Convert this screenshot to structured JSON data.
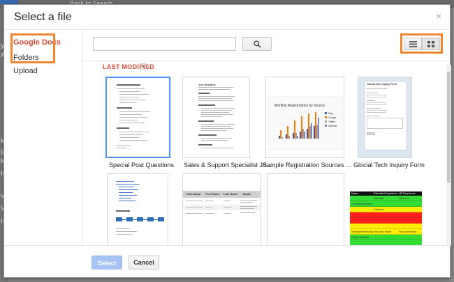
{
  "background": {
    "crumb": "Back to Search",
    "left_letters": [
      "y",
      "Al",
      "ket",
      "go",
      "ket",
      "lito",
      "vs",
      "Vi",
      "ini"
    ]
  },
  "dialog": {
    "title": "Select a file",
    "close_icon": "close-x-icon",
    "close_glyph": "×"
  },
  "nav": {
    "items": [
      {
        "label": "Google Docs",
        "active": true
      },
      {
        "label": "Folders",
        "active": false
      },
      {
        "label": "Upload",
        "active": false
      }
    ]
  },
  "toolbar": {
    "search_value": "",
    "search_icon": "search-icon",
    "list_view_icon": "list-view-icon",
    "grid_view_icon": "grid-view-icon"
  },
  "sort": {
    "label": "LAST MODIFIED"
  },
  "files": [
    {
      "name": "Special Post Questions",
      "selected": true
    },
    {
      "name": "Sales & Support Specialist Jo...",
      "selected": false
    },
    {
      "name": "Sample Registration Sources ...",
      "selected": false
    },
    {
      "name": "Glocial Tech Inquiry Form",
      "selected": false
    },
    {
      "name": "",
      "selected": false
    },
    {
      "name": "",
      "selected": false
    },
    {
      "name": "",
      "selected": false
    },
    {
      "name": "",
      "selected": false
    }
  ],
  "thumbnails": {
    "job_title": "Job Headline",
    "chart_title": "Monthly Registrations by Source",
    "chart_legend": [
      "Blog",
      "Google",
      "Twitter",
      "Website"
    ],
    "chart_legend_colors": [
      "#3f51b5",
      "#f57c00",
      "#9e9e9e",
      "#7986cb"
    ],
    "form_title": "Glocial Tech Inquiry Form",
    "table_headers": [
      "Timestamp",
      "First Name",
      "Last Name",
      "Email"
    ],
    "status_headers": [
      "Name",
      "Estimated Experience",
      "HR Experience"
    ],
    "status_rows": [
      {
        "c1": "",
        "c2": "Optimistic",
        "c3": "Optimistic",
        "color": "#33dd33"
      },
      {
        "c1": "Completed/Keeping",
        "c2": "",
        "c3": "",
        "color": "#33dd33"
      },
      {
        "c1": "",
        "c2": "Fastidious",
        "c3": "",
        "color": "#ffee00"
      },
      {
        "c1": "",
        "c2": "",
        "c3": "",
        "color": "#ff1f1f"
      },
      {
        "c1": "",
        "c2": "",
        "c3": "",
        "color": "#ff1f1f"
      },
      {
        "c1": "",
        "c2": "",
        "c3": "",
        "color": "#ffee00"
      },
      {
        "c1": "Unexplained Baloney",
        "c2": "Has some issues",
        "c3": "Has some issues",
        "color": "#ffee00"
      },
      {
        "c1": "Oblique Slapdash",
        "c2": "",
        "c3": "",
        "color": "#33dd33"
      },
      {
        "c1": "",
        "c2": "",
        "c3": "",
        "color": "#33dd33"
      }
    ]
  },
  "footer": {
    "select_label": "Select",
    "cancel_label": "Cancel"
  }
}
